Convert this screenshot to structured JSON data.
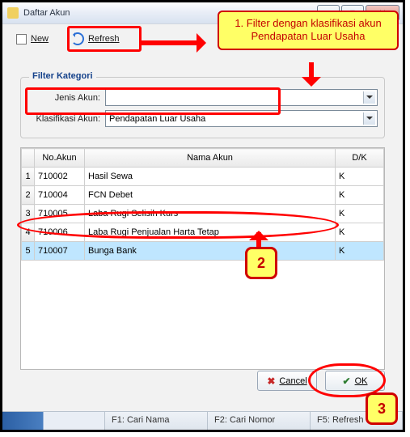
{
  "window": {
    "title": "Daftar Akun"
  },
  "toolbar": {
    "new_label": "New",
    "refresh_label": "Refresh"
  },
  "filter": {
    "legend": "Filter Kategori",
    "jenis_label": "Jenis Akun:",
    "jenis_value": "",
    "klas_label": "Klasifikasi Akun:",
    "klas_value": "Pendapatan Luar Usaha"
  },
  "table": {
    "headers": {
      "no": "No.Akun",
      "nama": "Nama Akun",
      "dk": "D/K"
    },
    "rows": [
      {
        "n": "1",
        "no": "710002",
        "nama": "Hasil Sewa",
        "dk": "K"
      },
      {
        "n": "2",
        "no": "710004",
        "nama": "FCN Debet",
        "dk": "K"
      },
      {
        "n": "3",
        "no": "710005",
        "nama": "Laba Rugi Selisih Kurs",
        "dk": "K"
      },
      {
        "n": "4",
        "no": "710006",
        "nama": "Laba Rugi Penjualan Harta Tetap",
        "dk": "K"
      },
      {
        "n": "5",
        "no": "710007",
        "nama": "Bunga Bank",
        "dk": "K"
      }
    ],
    "selected_index": 4
  },
  "buttons": {
    "cancel": "Cancel",
    "ok": "OK"
  },
  "status": {
    "f1": "F1: Cari Nama",
    "f2": "F2: Cari Nomor",
    "f5": "F5: Refresh"
  },
  "annotations": {
    "step1_text": "1. Filter dengan klasifikasi akun Pendapatan Luar Usaha",
    "step2": "2",
    "step3": "3"
  }
}
